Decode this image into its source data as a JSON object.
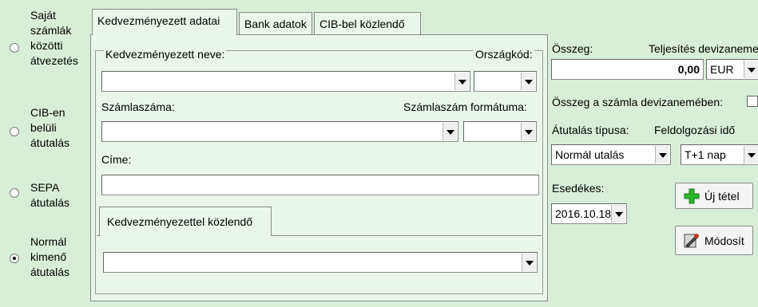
{
  "left_options": [
    {
      "lines": [
        "Saját",
        "számlák",
        "közötti",
        "átvezetés"
      ],
      "checked": false
    },
    {
      "lines": [
        "CIB-en",
        "belüli",
        "átutalás"
      ],
      "checked": false
    },
    {
      "lines": [
        "SEPA",
        "átutalás"
      ],
      "checked": false
    },
    {
      "lines": [
        "Normál",
        "kimenő",
        "átutalás"
      ],
      "checked": true
    }
  ],
  "tabs": {
    "beneficiary": "Kedvezményezett adatai",
    "bank": "Bank adatok",
    "cib_notice": "CIB-bel közlendő"
  },
  "beneficiary": {
    "name_label": "Kedvezményezett neve:",
    "country_label": "Országkód:",
    "name_value": "",
    "country_value": "",
    "account_label": "Számlaszáma:",
    "account_format_label": "Számlaszám formátuma:",
    "account_value": "",
    "account_format_value": "",
    "address_label": "Címe:",
    "address_value": "",
    "message_tab": "Kedvezményezettel közlendő",
    "message_value": ""
  },
  "amount": {
    "label": "Összeg:",
    "currency_label": "Teljesítés devizaneme",
    "value": "0,00",
    "currency": "EUR",
    "in_account_currency_label": "Összeg a számla devizanemében:"
  },
  "transfer": {
    "type_label": "Átutalás típusa:",
    "type_value": "Normál utalás",
    "processing_label": "Feldolgozási idő",
    "processing_value": "T+1 nap",
    "due_label": "Esedékes:",
    "due_value": "2016.10.18."
  },
  "buttons": {
    "new_item": "Új tétel",
    "modify": "Módosít"
  },
  "colors": {
    "background": "#d9eed9",
    "panel": "#eaf6ea",
    "plus_icon": "#2bb52b"
  }
}
